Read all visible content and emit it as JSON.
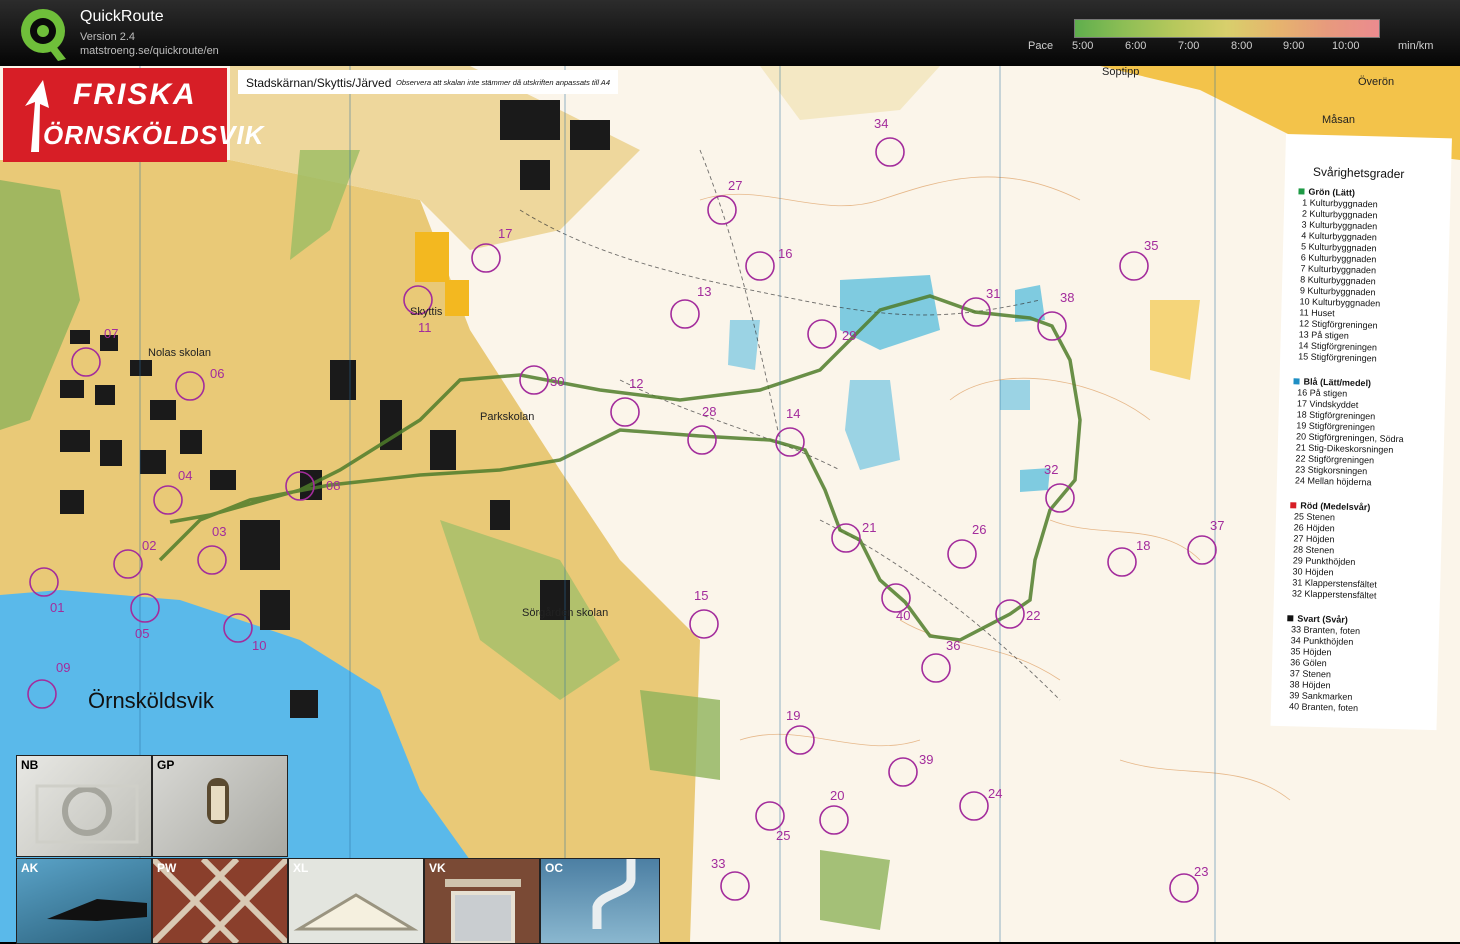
{
  "app": {
    "title": "QuickRoute",
    "version": "Version 2.4",
    "url": "matstroeng.se/quickroute/en"
  },
  "pace_scale": {
    "label": "Pace",
    "ticks": [
      "5:00",
      "6:00",
      "7:00",
      "8:00",
      "9:00",
      "10:00"
    ],
    "unit": "min/km"
  },
  "map": {
    "club_logo_line1": "FRISKA",
    "club_logo_line2": "ÖRNSKÖLDSVIK",
    "title": "Stadskärnan/Skyttis/Järved",
    "title_note": "Observera att skalan inte stämmer då utskriften anpassats till A4",
    "place_names": [
      "Soptipp",
      "Överön",
      "Måsan",
      "Örnsköldsvik",
      "Skyttis",
      "Nolas skolan",
      "Parkskolan",
      "Sörgården skolan"
    ],
    "controls": [
      "01",
      "02",
      "03",
      "04",
      "05",
      "06",
      "07",
      "08",
      "09",
      "10",
      "11",
      "12",
      "13",
      "14",
      "15",
      "16",
      "17",
      "18",
      "19",
      "20",
      "21",
      "22",
      "23",
      "24",
      "25",
      "26",
      "27",
      "28",
      "29",
      "30",
      "31",
      "32",
      "33",
      "34",
      "35",
      "36",
      "37",
      "38",
      "39",
      "40"
    ]
  },
  "legend": {
    "title": "Svårighetsgrader",
    "sections": [
      {
        "header": "Grön (Lätt)",
        "color": "#1e9a45",
        "items": [
          "1  Kulturbyggnaden",
          "2  Kulturbyggnaden",
          "3  Kulturbyggnaden",
          "4  Kulturbyggnaden",
          "5  Kulturbyggnaden",
          "6  Kulturbyggnaden",
          "7  Kulturbyggnaden",
          "8  Kulturbyggnaden",
          "9  Kulturbyggnaden",
          "10 Kulturbyggnaden",
          "11 Huset",
          "12 Stigförgreningen",
          "13 På stigen",
          "14 Stigförgreningen",
          "15 Stigförgreningen"
        ]
      },
      {
        "header": "Blå (Lätt/medel)",
        "color": "#1f8fc4",
        "items": [
          "16 På stigen",
          "17 Vindskyddet",
          "18 Stigförgreningen",
          "19 Stigförgreningen",
          "20 Stigförgreningen, Södra",
          "21 Stig-Dikeskorsningen",
          "22 Stigförgreningen",
          "23 Stigkorsningen",
          "24 Mellan höjderna"
        ]
      },
      {
        "header": "Röd (Medelsvår)",
        "color": "#d71e26",
        "items": [
          "25 Stenen",
          "26 Höjden",
          "27 Höjden",
          "28 Stenen",
          "29 Punkthöjden",
          "30 Höjden",
          "31 Klapperstensfältet",
          "32 Klapperstensfältet"
        ]
      },
      {
        "header": "Svart (Svår)",
        "color": "#111111",
        "items": [
          "33 Branten, foten",
          "34 Punkthöjden",
          "35 Höjden",
          "36 Gölen",
          "37 Stenen",
          "38 Höjden",
          "39 Sankmarken",
          "40 Branten, foten"
        ]
      }
    ]
  },
  "photos": [
    {
      "code": "NB"
    },
    {
      "code": "GP"
    },
    {
      "code": "AK"
    },
    {
      "code": "PW"
    },
    {
      "code": "XL"
    },
    {
      "code": "VK"
    },
    {
      "code": "OC"
    }
  ],
  "colors": {
    "forest": "#fdfcf2",
    "open_land": "#f7d36b",
    "urban": "#e9c977",
    "building": "#1a1a1a",
    "water": "#5ab9ea",
    "marsh": "#7fcbe0",
    "control_circle": "#a32c9c",
    "route": "#4f7d2a",
    "logo_red": "#d71e26"
  }
}
